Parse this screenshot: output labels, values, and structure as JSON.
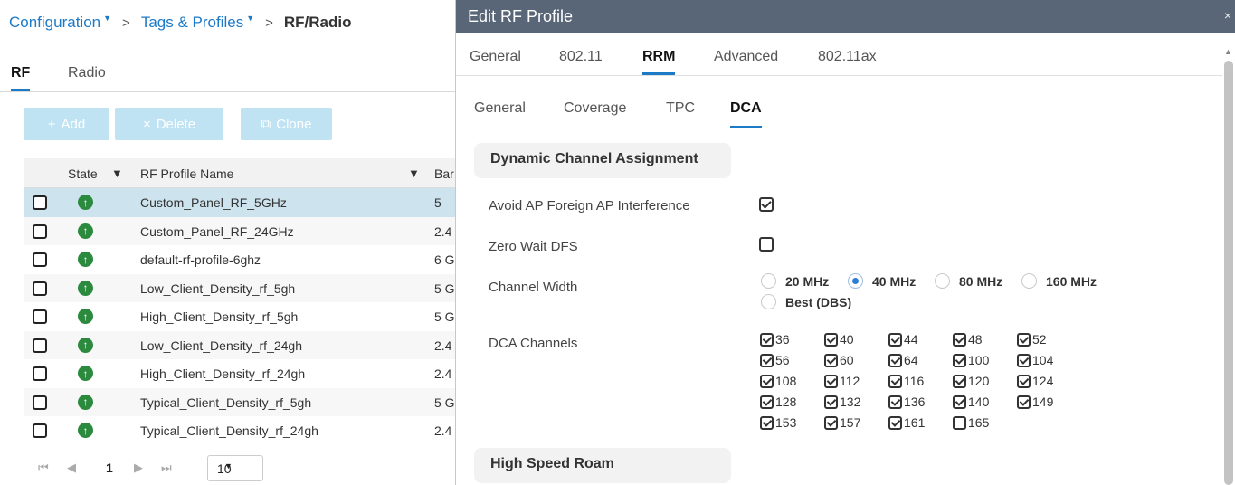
{
  "breadcrumb": {
    "items": [
      "Configuration",
      "Tags & Profiles"
    ],
    "current": "RF/Radio",
    "separator": ">",
    "caret": "▼"
  },
  "left_tabs": [
    "RF",
    "Radio"
  ],
  "toolbar": {
    "add": "Add",
    "delete": "Delete",
    "clone": "Clone"
  },
  "grid": {
    "headers": {
      "state": "State",
      "name": "RF Profile Name",
      "band": "Bar"
    },
    "rows": [
      {
        "name": "Custom_Panel_RF_5GHz",
        "band": "5"
      },
      {
        "name": "Custom_Panel_RF_24GHz",
        "band": "2.4"
      },
      {
        "name": "default-rf-profile-6ghz",
        "band": "6 G"
      },
      {
        "name": "Low_Client_Density_rf_5gh",
        "band": "5 G"
      },
      {
        "name": "High_Client_Density_rf_5gh",
        "band": "5 G"
      },
      {
        "name": "Low_Client_Density_rf_24gh",
        "band": "2.4"
      },
      {
        "name": "High_Client_Density_rf_24gh",
        "band": "2.4"
      },
      {
        "name": "Typical_Client_Density_rf_5gh",
        "band": "5 G"
      },
      {
        "name": "Typical_Client_Density_rf_24gh",
        "band": "2.4"
      }
    ]
  },
  "pager": {
    "page": "1",
    "per_page": "10"
  },
  "modal": {
    "title": "Edit RF Profile",
    "close": "×",
    "tabs": [
      "General",
      "802.11",
      "RRM",
      "Advanced",
      "802.11ax"
    ],
    "subtabs": [
      "General",
      "Coverage",
      "TPC",
      "DCA"
    ],
    "section_dca": "Dynamic Channel Assignment",
    "avoid_label": "Avoid AP Foreign AP Interference",
    "zero_wait_label": "Zero Wait DFS",
    "channel_width_label": "Channel Width",
    "widths": [
      "20 MHz",
      "40 MHz",
      "80 MHz",
      "160 MHz",
      "Best (DBS)"
    ],
    "dca_channels_label": "DCA Channels",
    "channels": [
      "36",
      "40",
      "44",
      "48",
      "52",
      "56",
      "60",
      "64",
      "100",
      "104",
      "108",
      "112",
      "116",
      "120",
      "124",
      "128",
      "132",
      "136",
      "140",
      "149",
      "153",
      "157",
      "161",
      "165"
    ],
    "section_hsr": "High Speed Roam"
  },
  "state": {
    "active_left_tab": "RF",
    "active_modal_tab": "RRM",
    "active_subtab": "DCA",
    "selected_row": 0,
    "avoid_foreign": true,
    "zero_wait_dfs": false,
    "channel_width": "40 MHz",
    "unchecked_channels": [
      "165"
    ]
  },
  "colors": {
    "accent": "#1d7ac6",
    "header_bar": "#596677",
    "state_up": "#2b8a3e",
    "selected_row": "#cde4ef"
  }
}
